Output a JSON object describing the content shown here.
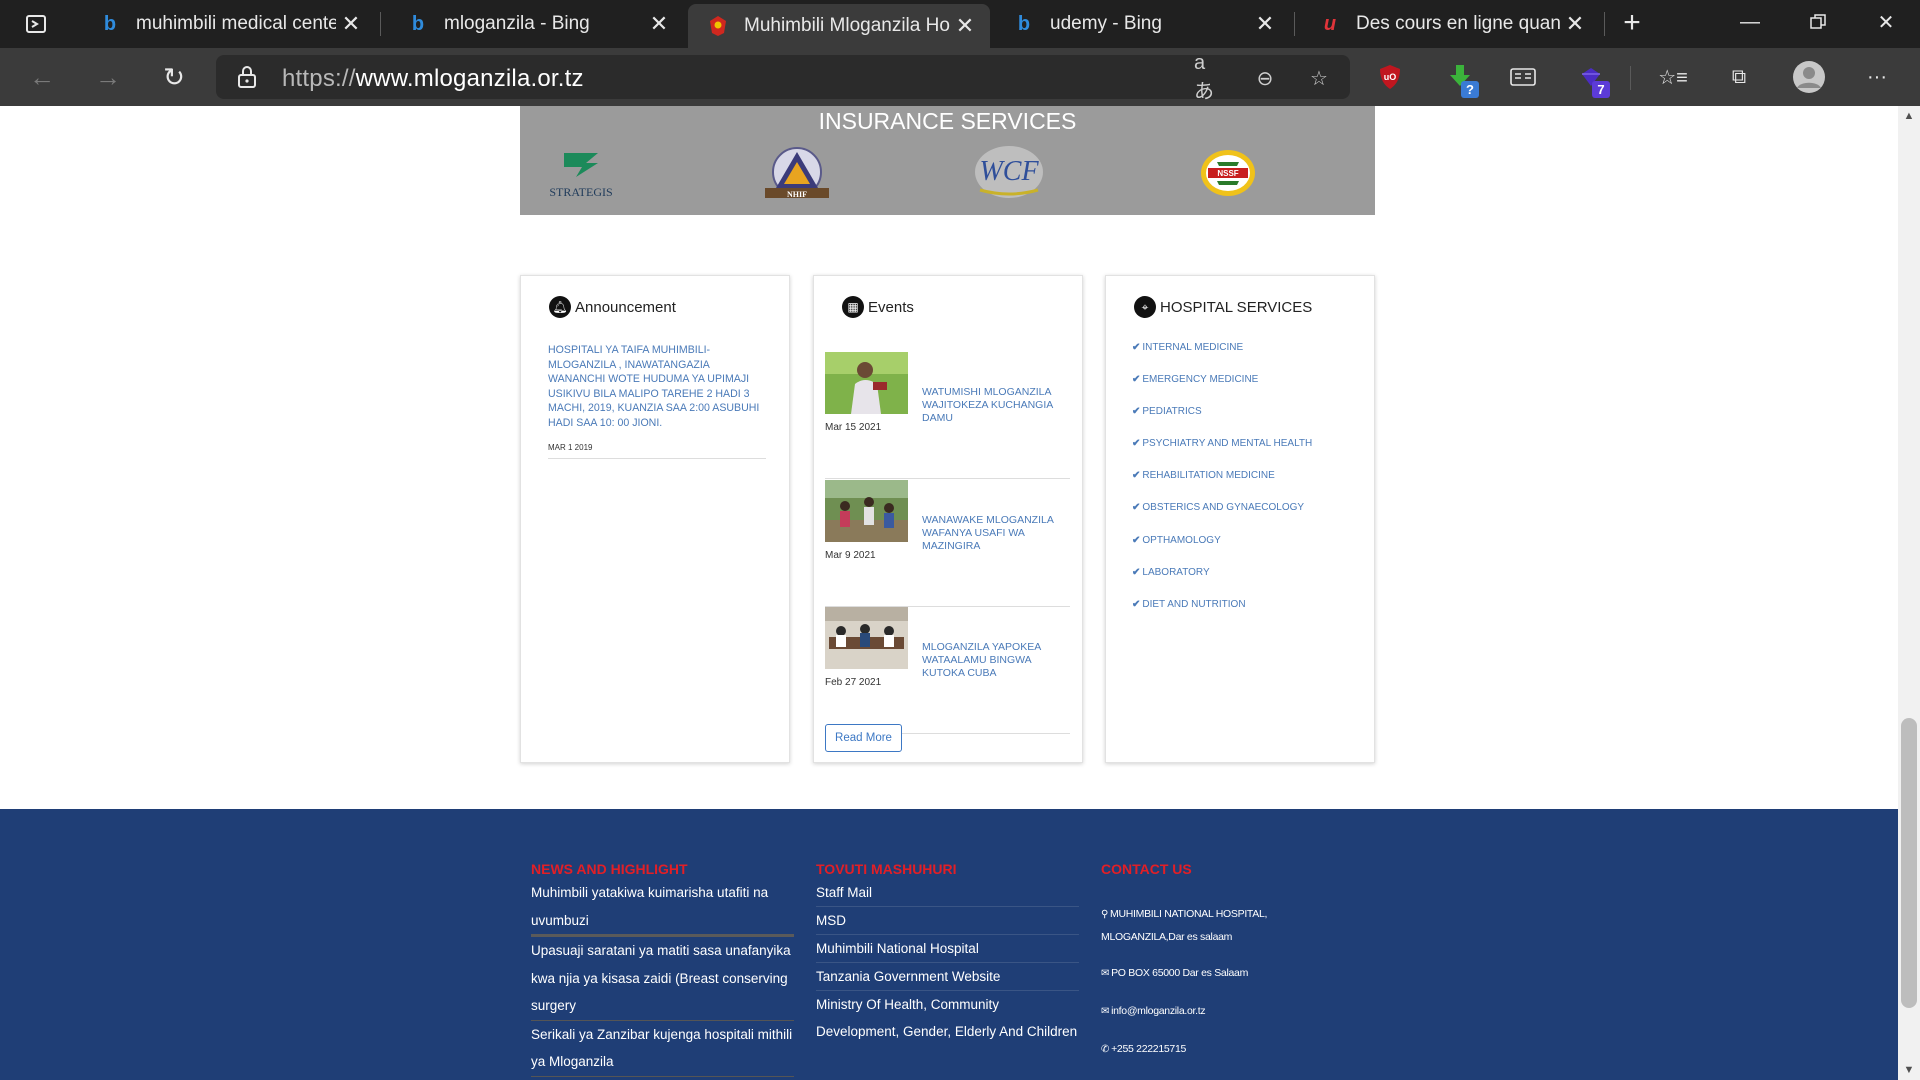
{
  "browser": {
    "tabs": [
      {
        "title": "muhimbili medical center",
        "favicon": "bing-icon",
        "active": false
      },
      {
        "title": "mloganzila - Bing",
        "favicon": "bing-icon",
        "active": false
      },
      {
        "title": "Muhimbili Mloganzila Hos",
        "favicon": "hospital-crest-icon",
        "active": true
      },
      {
        "title": "udemy - Bing",
        "favicon": "bing-icon",
        "active": false
      },
      {
        "title": "Des cours en ligne quand",
        "favicon": "udemy-icon",
        "active": false
      }
    ],
    "address": {
      "protocol": "https://",
      "host": "www.mloganzila.or.tz"
    },
    "extensions": {
      "download_badge": "?",
      "extension_badge": "7"
    },
    "colors": {
      "chrome_dark": "#202020",
      "toolbar": "#3b3b3b",
      "ublock": "#c0161f",
      "download": "#3bb33b"
    }
  },
  "page": {
    "insurance": {
      "heading": "INSURANCE SERVICES",
      "logos": [
        {
          "name": "strategis-logo",
          "caption": "STRATEGIS"
        },
        {
          "name": "nhif-logo",
          "caption": "NHIF"
        },
        {
          "name": "wcf-logo",
          "caption": "WCF"
        },
        {
          "name": "nssf-logo",
          "caption": "NSSF"
        }
      ]
    },
    "announcement": {
      "heading": "Announcement",
      "text": "HOSPITALI YA TAIFA MUHIMBILI-MLOGANZILA , INAWATANGAZIA WANANCHI WOTE HUDUMA YA UPIMAJI USIKIVU BILA MALIPO TAREHE 2 HADI 3 MACHI, 2019, KUANZIA SAA 2:00 ASUBUHI HADI SAA 10: 00 JIONI.",
      "date": "MAR 1 2019"
    },
    "events": {
      "heading": "Events",
      "items": [
        {
          "title": "WATUMISHI MLOGANZILA WAJITOKEZA KUCHANGIA DAMU",
          "date": "Mar 15 2021"
        },
        {
          "title": "WANAWAKE MLOGANZILA WAFANYA USAFI WA MAZINGIRA",
          "date": "Mar 9 2021"
        },
        {
          "title": "MLOGANZILA YAPOKEA WATAALAMU BINGWA KUTOKA CUBA",
          "date": "Feb 27 2021"
        }
      ],
      "read_more": "Read More"
    },
    "services": {
      "heading": "HOSPITAL SERVICES",
      "items": [
        "INTERNAL MEDICINE",
        "EMERGENCY MEDICINE",
        "PEDIATRICS",
        "PSYCHIATRY AND MENTAL HEALTH",
        "REHABILITATION MEDICINE",
        "OBSTERICS AND GYNAECOLOGY",
        "OPTHAMOLOGY",
        "LABORATORY",
        "DIET AND NUTRITION"
      ]
    },
    "footer": {
      "news": {
        "heading": "NEWS AND HIGHLIGHT",
        "items": [
          "Muhimbili yatakiwa kuimarisha utafiti na uvumbuzi",
          "Upasuaji saratani ya matiti sasa unafanyika kwa njia ya kisasa zaidi (Breast conserving surgery",
          "Serikali ya Zanzibar kujenga hospitali mithili ya Mloganzila"
        ]
      },
      "links": {
        "heading": "TOVUTI MASHUHURI",
        "items": [
          "Staff Mail",
          "MSD",
          "Muhimbili National Hospital",
          "Tanzania Government Website",
          "Ministry Of Health, Community Development, Gender, Elderly And Children"
        ]
      },
      "contact": {
        "heading": "CONTACT US",
        "address": "MUHIMBILI NATIONAL HOSPITAL, MLOGANZILA,Dar es salaam",
        "pobox": "PO BOX 65000 Dar es Salaam",
        "email": "info@mloganzila.or.tz",
        "phone": "+255 222215715"
      },
      "colors": {
        "background": "#1f3e76",
        "heading": "#e21f26"
      }
    },
    "colors": {
      "link_blue": "#4a7ab8",
      "insurance_bg": "#9b9b9b"
    }
  }
}
